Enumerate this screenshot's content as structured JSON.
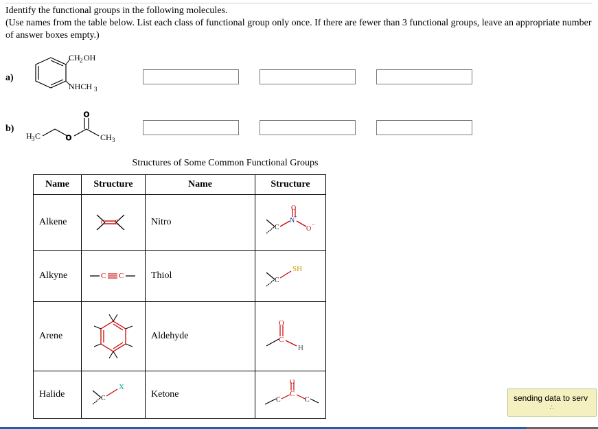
{
  "instructions": {
    "line1": "Identify the functional groups in the following molecules.",
    "line2": "(Use names from the table below. List each class of functional group only once. If there are fewer than 3 functional groups, leave an appropriate number of answer boxes empty.)"
  },
  "questions": [
    {
      "label": "a)",
      "molecule_top": "CH₂OH",
      "molecule_bottom": "NHCH₃",
      "answers": [
        "",
        "",
        ""
      ]
    },
    {
      "label": "b)",
      "molecule_left": "H₃C",
      "molecule_right": "CH₃",
      "answers": [
        "",
        "",
        ""
      ]
    }
  ],
  "table_title": "Structures of Some Common Functional Groups",
  "table_headers": [
    "Name",
    "Structure",
    "Name",
    "Structure"
  ],
  "table_rows": [
    {
      "name1": "Alkene",
      "name2": "Nitro"
    },
    {
      "name1": "Alkyne",
      "name2": "Thiol"
    },
    {
      "name1": "Arene",
      "name2": "Aldehyde"
    },
    {
      "name1": "Halide",
      "name2": "Ketone"
    }
  ],
  "toast": "sending data to serv",
  "chart_data": {
    "type": "table",
    "title": "Structures of Some Common Functional Groups",
    "columns": [
      "Name",
      "Structure",
      "Name",
      "Structure"
    ],
    "rows": [
      [
        "Alkene",
        "C=C with 4 substituents",
        "Nitro",
        "C-N(+)(=O)O(-)"
      ],
      [
        "Alkyne",
        "-C≡C-",
        "Thiol",
        "C-SH"
      ],
      [
        "Arene",
        "benzene ring with substituents",
        "Aldehyde",
        "C-C(=O)-H"
      ],
      [
        "Halide",
        "C-X",
        "Ketone",
        "C-C(=O)-C"
      ]
    ]
  }
}
